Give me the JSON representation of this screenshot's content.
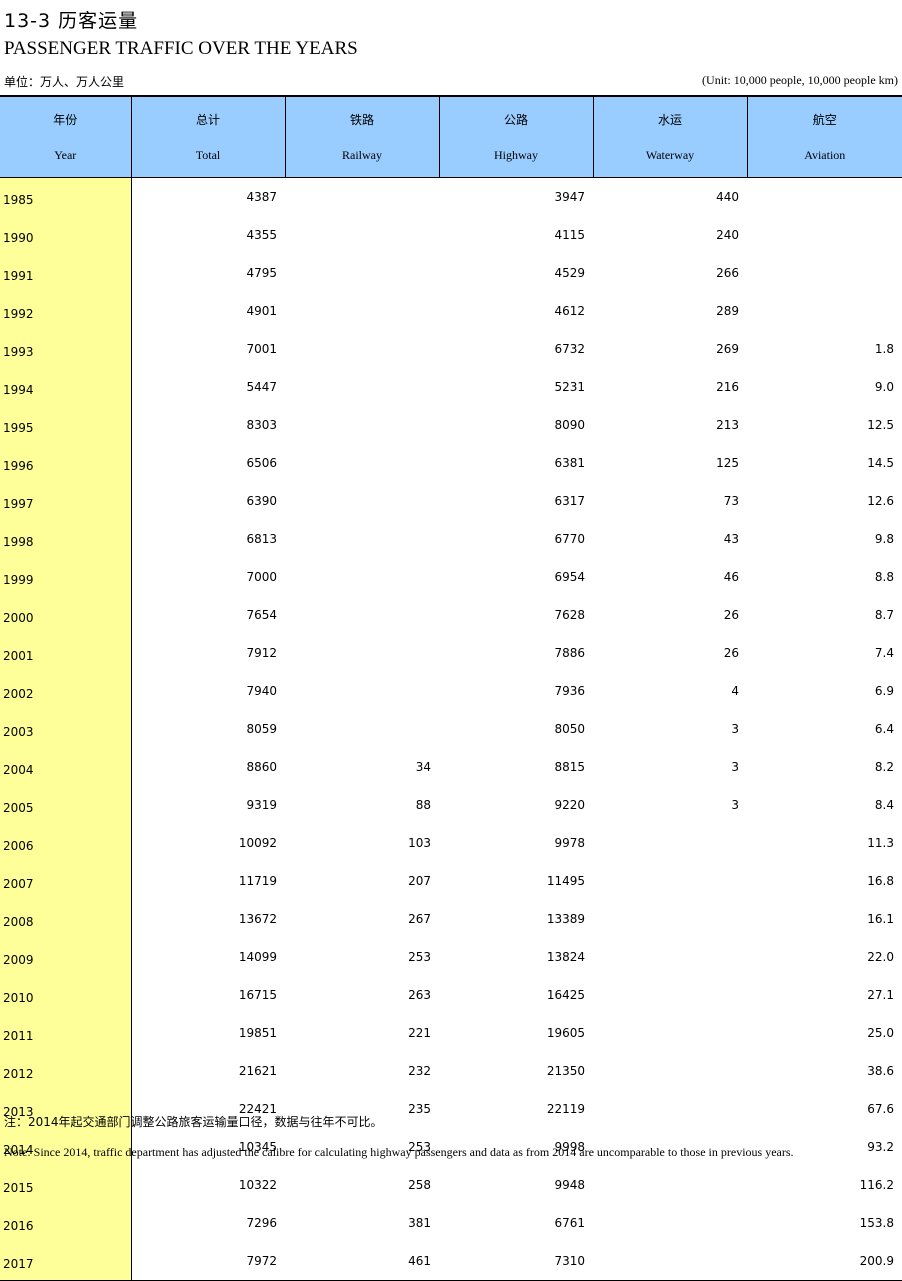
{
  "title_cn": "13-3  历客运量",
  "title_en": "PASSENGER TRAFFIC OVER THE YEARS",
  "unit_cn": "单位：万人、万人公里",
  "unit_en": "(Unit: 10,000 people, 10,000 people km)",
  "headers": [
    {
      "cn": "年份",
      "en": "Year"
    },
    {
      "cn": "总计",
      "en": "Total"
    },
    {
      "cn": "铁路",
      "en": "Railway"
    },
    {
      "cn": "公路",
      "en": "Highway"
    },
    {
      "cn": "水运",
      "en": "Waterway"
    },
    {
      "cn": "航空",
      "en": "Aviation"
    }
  ],
  "rows": [
    [
      "1985",
      "4387",
      "",
      "3947",
      "440",
      ""
    ],
    [
      "1990",
      "4355",
      "",
      "4115",
      "240",
      ""
    ],
    [
      "1991",
      "4795",
      "",
      "4529",
      "266",
      ""
    ],
    [
      "1992",
      "4901",
      "",
      "4612",
      "289",
      ""
    ],
    [
      "1993",
      "7001",
      "",
      "6732",
      "269",
      "1.8"
    ],
    [
      "1994",
      "5447",
      "",
      "5231",
      "216",
      "9.0"
    ],
    [
      "1995",
      "8303",
      "",
      "8090",
      "213",
      "12.5"
    ],
    [
      "1996",
      "6506",
      "",
      "6381",
      "125",
      "14.5"
    ],
    [
      "1997",
      "6390",
      "",
      "6317",
      "73",
      "12.6"
    ],
    [
      "1998",
      "6813",
      "",
      "6770",
      "43",
      "9.8"
    ],
    [
      "1999",
      "7000",
      "",
      "6954",
      "46",
      "8.8"
    ],
    [
      "2000",
      "7654",
      "",
      "7628",
      "26",
      "8.7"
    ],
    [
      "2001",
      "7912",
      "",
      "7886",
      "26",
      "7.4"
    ],
    [
      "2002",
      "7940",
      "",
      "7936",
      "4",
      "6.9"
    ],
    [
      "2003",
      "8059",
      "",
      "8050",
      "3",
      "6.4"
    ],
    [
      "2004",
      "8860",
      "34",
      "8815",
      "3",
      "8.2"
    ],
    [
      "2005",
      "9319",
      "88",
      "9220",
      "3",
      "8.4"
    ],
    [
      "2006",
      "10092",
      "103",
      "9978",
      "",
      "11.3"
    ],
    [
      "2007",
      "11719",
      "207",
      "11495",
      "",
      "16.8"
    ],
    [
      "2008",
      "13672",
      "267",
      "13389",
      "",
      "16.1"
    ],
    [
      "2009",
      "14099",
      "253",
      "13824",
      "",
      "22.0"
    ],
    [
      "2010",
      "16715",
      "263",
      "16425",
      "",
      "27.1"
    ],
    [
      "2011",
      "19851",
      "221",
      "19605",
      "",
      "25.0"
    ],
    [
      "2012",
      "21621",
      "232",
      "21350",
      "",
      "38.6"
    ],
    [
      "2013",
      "22421",
      "235",
      "22119",
      "",
      "67.6"
    ],
    [
      "2014",
      "10345",
      "253",
      "9998",
      "",
      "93.2"
    ],
    [
      "2015",
      "10322",
      "258",
      "9948",
      "",
      "116.2"
    ],
    [
      "2016",
      "7296",
      "381",
      "6761",
      "",
      "153.8"
    ],
    [
      "2017",
      "7972",
      "461",
      "7310",
      "",
      "200.9"
    ]
  ],
  "note_cn": "注：2014年起交通部门调整公路旅客运输量口径，数据与往年不可比。",
  "note_en": "Note: Since 2014, traffic department has adjusted the calibre for calculating highway passengers and data as from 2014 are uncomparable to those in previous years.",
  "colors": {
    "header_bg": "#99ccff",
    "year_col_bg": "#ffff99"
  }
}
